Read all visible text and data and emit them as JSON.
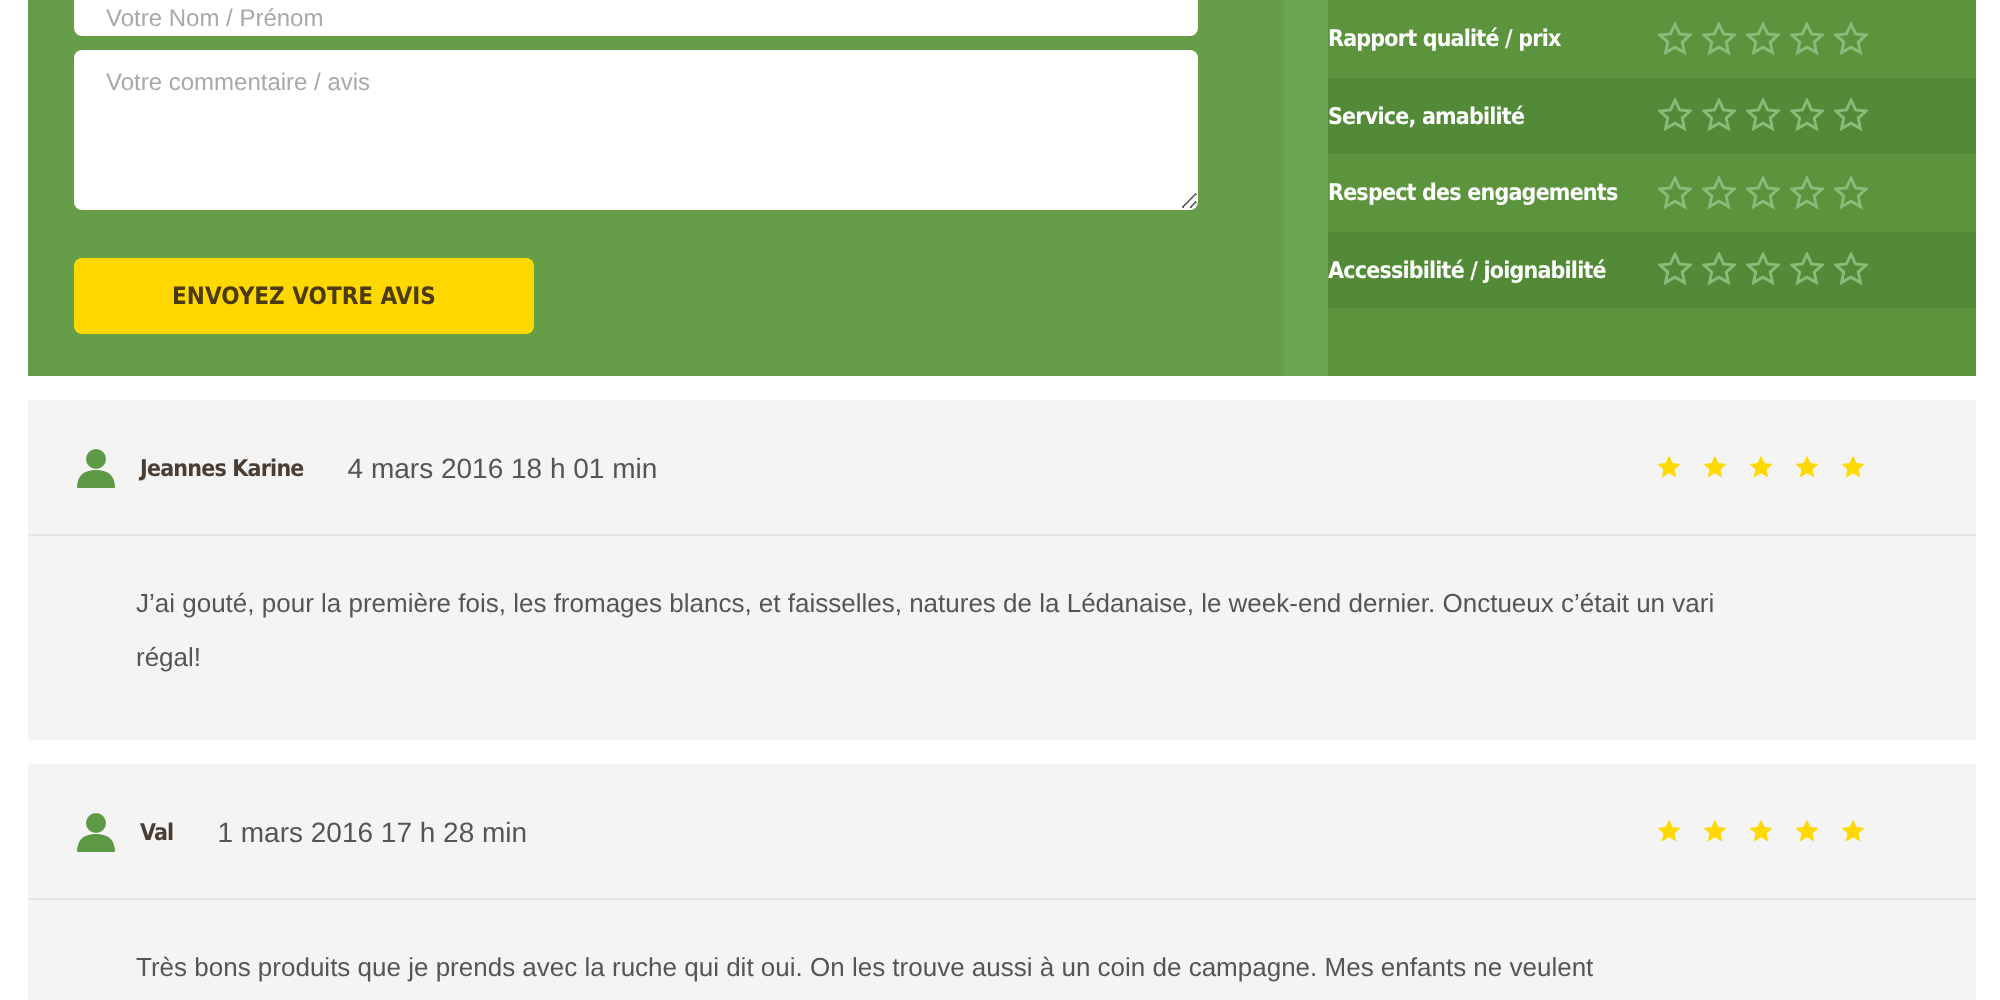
{
  "form": {
    "name_field": {
      "placeholder": "Votre Nom / Prénom"
    },
    "comment_field": {
      "placeholder": "Votre commentaire / avis"
    },
    "submit_button": "ENVOYEZ VOTRE AVIS"
  },
  "ratings": [
    {
      "label": "Rapport qualité / prix",
      "stars": 0
    },
    {
      "label": "Service, amabilité",
      "stars": 0
    },
    {
      "label": "Respect des engagements",
      "stars": 0
    },
    {
      "label": "Accessibilité / joignabilité",
      "stars": 0
    }
  ],
  "reviews": [
    {
      "author": "Jeannes Karine",
      "date": "4 mars 2016 18 h 01 min",
      "stars": 5,
      "text": "J’ai gouté, pour la première fois, les fromages blancs, et faisselles, natures de la Lédanaise, le week-end dernier. Onctueux c’était un vari régal!"
    },
    {
      "author": "Val",
      "date": "1 mars 2016 17 h 28 min",
      "stars": 5,
      "text": "Très bons produits que je prends avec la ruche qui dit oui. On les trouve aussi à un coin de campagne. Mes enfants ne veulent"
    }
  ]
}
